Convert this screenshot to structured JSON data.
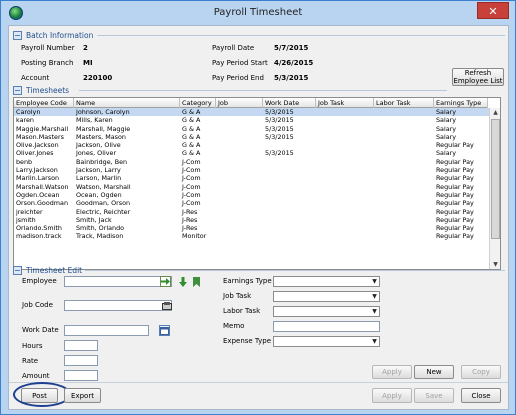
{
  "window": {
    "title": "Payroll Timesheet",
    "close_label": "✕"
  },
  "batch": {
    "section_title": "Batch Information",
    "payroll_number_label": "Payroll Number",
    "payroll_number": "2",
    "posting_branch_label": "Posting Branch",
    "posting_branch": "MI",
    "account_label": "Account",
    "account": "220100",
    "payroll_date_label": "Payroll Date",
    "payroll_date": "5/7/2015",
    "period_start_label": "Pay Period Start",
    "period_start": "4/26/2015",
    "period_end_label": "Pay Period End",
    "period_end": "5/3/2015",
    "refresh_label": "Refresh Employee List"
  },
  "timesheets": {
    "section_title": "Timesheets",
    "columns": [
      "Employee Code",
      "Name",
      "Category",
      "Job",
      "Work Date",
      "Job Task",
      "Labor Task",
      "Earnings Type"
    ],
    "rows": [
      [
        "Carolyn",
        "Johnson, Carolyn",
        "G & A",
        "",
        "5/3/2015",
        "",
        "",
        "Salary"
      ],
      [
        "karen",
        "Mills, Karen",
        "G & A",
        "",
        "5/3/2015",
        "",
        "",
        "Salary"
      ],
      [
        "Maggie.Marshall",
        "Marshall, Maggie",
        "G & A",
        "",
        "5/3/2015",
        "",
        "",
        "Salary"
      ],
      [
        "Mason.Masters",
        "Masters, Mason",
        "G & A",
        "",
        "5/3/2015",
        "",
        "",
        "Salary"
      ],
      [
        "Olive.Jackson",
        "Jackson, Olive",
        "G & A",
        "",
        "",
        "",
        "",
        "Regular Pay"
      ],
      [
        "Oliver.Jones",
        "Jones, Oliver",
        "G & A",
        "",
        "5/3/2015",
        "",
        "",
        "Salary"
      ],
      [
        "benb",
        "Bainbridge, Ben",
        "J-Com",
        "",
        "",
        "",
        "",
        "Regular Pay"
      ],
      [
        "Larry.Jackson",
        "Jackson, Larry",
        "J-Com",
        "",
        "",
        "",
        "",
        "Regular Pay"
      ],
      [
        "Marlin.Larson",
        "Larson, Marlin",
        "J-Com",
        "",
        "",
        "",
        "",
        "Regular Pay"
      ],
      [
        "Marshall.Watson",
        "Watson, Marshall",
        "J-Com",
        "",
        "",
        "",
        "",
        "Regular Pay"
      ],
      [
        "Ogden.Ocean",
        "Ocean, Ogden",
        "J-Com",
        "",
        "",
        "",
        "",
        "Regular Pay"
      ],
      [
        "Orson.Goodman",
        "Goodman, Orson",
        "J-Com",
        "",
        "",
        "",
        "",
        "Regular Pay"
      ],
      [
        "jreichter",
        "Electric, Reichter",
        "J-Res",
        "",
        "",
        "",
        "",
        "Regular Pay"
      ],
      [
        "jsmith",
        "Smith, Jack",
        "J-Res",
        "",
        "",
        "",
        "",
        "Regular Pay"
      ],
      [
        "Orlando.Smith",
        "Smith, Orlando",
        "J-Res",
        "",
        "",
        "",
        "",
        "Regular Pay"
      ],
      [
        "madison.track",
        "Track, Madison",
        "Monitor",
        "",
        "",
        "",
        "",
        "Regular Pay"
      ]
    ]
  },
  "edit": {
    "section_title": "Timesheet Edit",
    "employee_label": "Employee",
    "job_code_label": "Job Code",
    "work_date_label": "Work Date",
    "hours_label": "Hours",
    "rate_label": "Rate",
    "amount_label": "Amount",
    "earnings_type_label": "Earnings Type",
    "job_task_label": "Job Task",
    "labor_task_label": "Labor Task",
    "memo_label": "Memo",
    "expense_type_label": "Expense Type",
    "apply_label": "Apply",
    "new_label": "New",
    "copy_label": "Copy"
  },
  "footer": {
    "post_label": "Post",
    "export_label": "Export",
    "apply_label": "Apply",
    "save_label": "Save",
    "close_label": "Close"
  },
  "colors": {
    "accent": "#1f4e8f",
    "titlebar": "#b9d4f0",
    "selection": "#c4d9f1",
    "close": "#c8403a"
  }
}
